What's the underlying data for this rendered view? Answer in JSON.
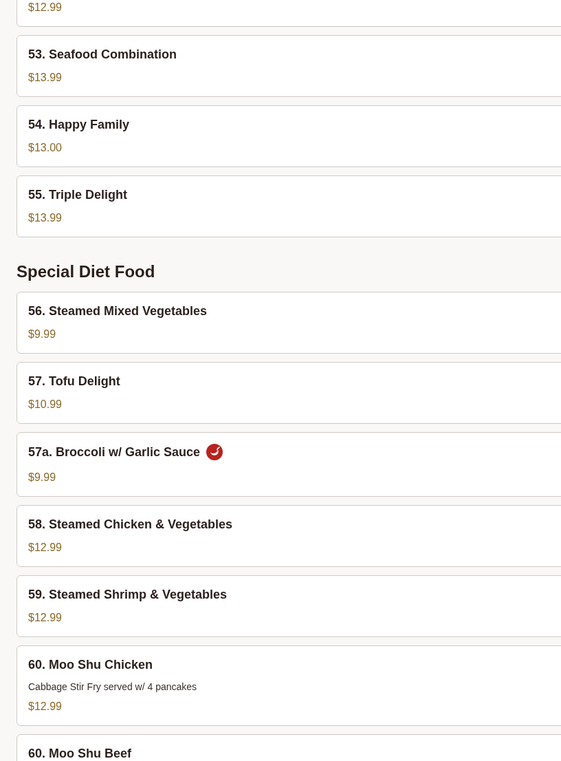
{
  "sections": [
    {
      "items": [
        {
          "price": "$12.99",
          "spicy": false
        },
        {
          "name": "53. Seafood Combination",
          "price": "$13.99",
          "spicy": false
        },
        {
          "name": "54. Happy Family",
          "price": "$13.00",
          "spicy": false
        },
        {
          "name": "55. Triple Delight",
          "price": "$13.99",
          "spicy": false
        }
      ]
    },
    {
      "title": "Special Diet Food",
      "items": [
        {
          "name": "56. Steamed Mixed Vegetables",
          "price": "$9.99",
          "spicy": false
        },
        {
          "name": "57. Tofu Delight",
          "price": "$10.99",
          "spicy": false
        },
        {
          "name": "57a. Broccoli w/ Garlic Sauce",
          "price": "$9.99",
          "spicy": true
        },
        {
          "name": "58. Steamed Chicken & Vegetables",
          "price": "$12.99",
          "spicy": false
        },
        {
          "name": "59. Steamed Shrimp & Vegetables",
          "price": "$12.99",
          "spicy": false
        },
        {
          "name": "60. Moo Shu Chicken",
          "description": "Cabbage Stir Fry served w/ 4 pancakes",
          "price": "$12.99",
          "spicy": false
        },
        {
          "name": "60. Moo Shu Beef",
          "spicy": false
        }
      ]
    }
  ]
}
